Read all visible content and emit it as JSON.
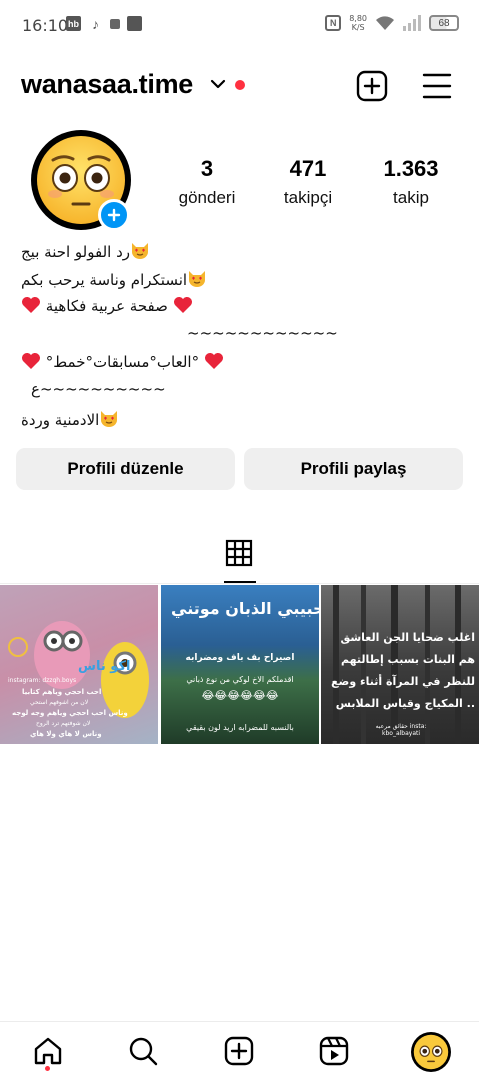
{
  "status_bar": {
    "time": "16:10",
    "app_icons": [
      "hb",
      "tiktok-icon",
      "square-icon",
      "square-icon"
    ],
    "nfc": "N",
    "speed_value": "8,80",
    "speed_unit": "K/S",
    "battery": "68"
  },
  "header": {
    "username": "wanasaa.time",
    "has_notification_dot": true
  },
  "profile": {
    "stats": [
      {
        "value": "3",
        "label": "gönderi"
      },
      {
        "value": "471",
        "label": "takipçi"
      },
      {
        "value": "1.363",
        "label": "takip"
      }
    ],
    "bio_lines": [
      "رد الفولو احنة بيج",
      "انستكرام وناسة يرحب بكم",
      "صفحة عربية فكاهية",
      "~~~~~~~~~~~~",
      "°العاب°مسابقات°خمط°",
      "ع~~~~~~~~~~",
      "الادمنية وردة"
    ]
  },
  "buttons": {
    "edit_profile": "Profili düzenle",
    "share_profile": "Profili paylaş"
  },
  "posts": [
    {
      "title": "اكو ناس",
      "lines": [
        "احب احجي وياهم كتابيا",
        "لان من اشوفهم استحي",
        "وناس احب احجي وياهم وجه لوجه",
        "لان شوفتهم ترد الروح",
        "وناس لا هاي ولا هاي"
      ],
      "watermark": "instagram: dzzqh.boys"
    },
    {
      "title": "حبيبي الذبان موتني",
      "lines": [
        "اصيراح بف باف ومضرابه",
        "اقدملكم الاخ لوكي من نوع ذباني",
        "بالنسبه للمضرابه اريد لون بقيقي"
      ],
      "watermark": ""
    },
    {
      "title": "",
      "lines": [
        "اغلب ضحايا الجن العاشق",
        "هم البنات بسبب إطالتهم",
        "للنظر في المرآة أثناء وضع",
        "المكياج وقياس الملابس .."
      ],
      "watermark": "حقائق مرعبه insta: kbo_albayati"
    }
  ],
  "colors": {
    "accent_blue": "#0095f6",
    "notification_red": "#ff3040",
    "button_bg": "#efefef"
  }
}
